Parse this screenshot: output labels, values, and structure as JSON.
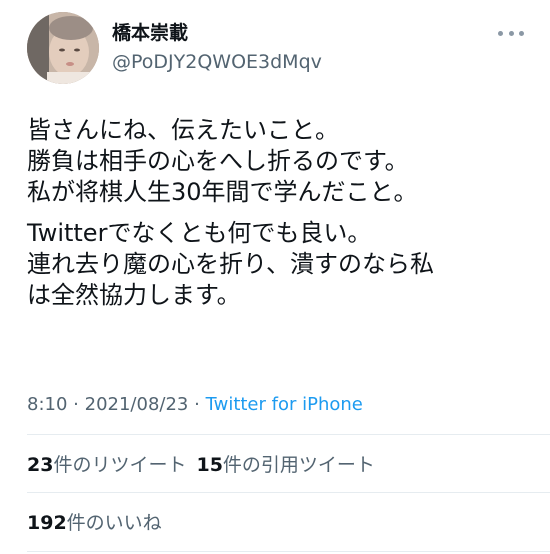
{
  "author": {
    "name": "橋本崇載",
    "handle": "@PoDJY2QWOE3dMqv"
  },
  "tweet": {
    "paragraphs": [
      [
        "皆さんにね、伝えたいこと。",
        "勝負は相手の心をへし折るのです。",
        "私が将棋人生30年間で学んだこと。"
      ],
      [
        "Twitterでなくとも何でも良い。",
        "連れ去り魔の心を折り、潰すのなら私",
        "は全然協力します。"
      ]
    ],
    "time": "8:10",
    "separator": "·",
    "date": "2021/08/23",
    "source": "Twitter for iPhone"
  },
  "stats": {
    "retweets_count": "23",
    "retweets_label": "件のリツイート",
    "quotes_count": "15",
    "quotes_label": "件の引用ツイート",
    "likes_count": "192",
    "likes_label": "件のいいね"
  },
  "icons": {
    "more": "more-horizontal-icon",
    "avatar": "avatar-photo"
  },
  "colors": {
    "text": "#0f1419",
    "secondary": "#536471",
    "link": "#1d9bf0",
    "divider": "#e6ecf0"
  }
}
